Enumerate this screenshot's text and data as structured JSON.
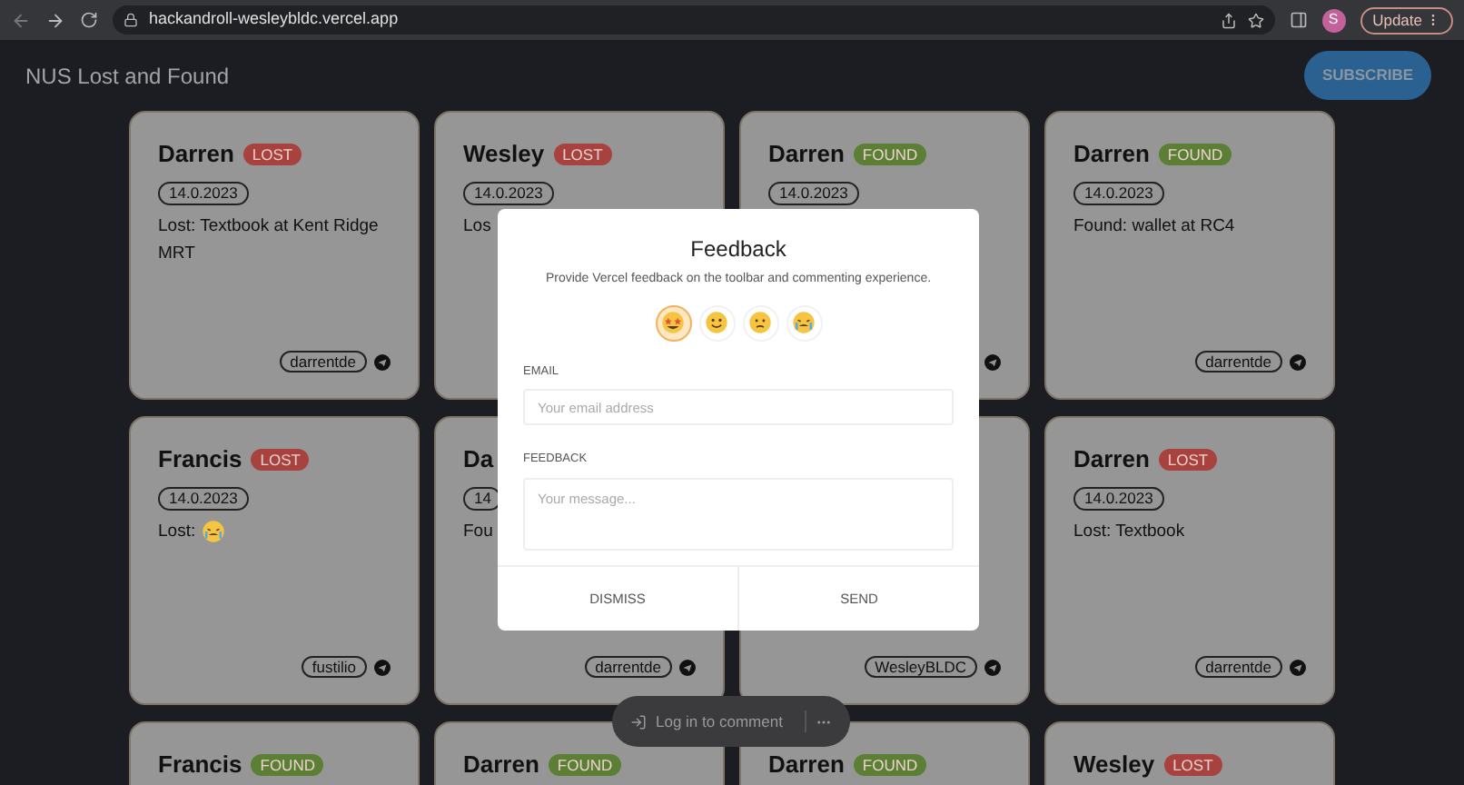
{
  "browser": {
    "url": "hackandroll-wesleybldc.vercel.app",
    "profile_initial": "S",
    "update_label": "Update"
  },
  "header": {
    "title": "NUS Lost and Found",
    "subscribe": "SUBSCRIBE"
  },
  "cards": [
    {
      "name": "Darren",
      "badge": "LOST",
      "color": "#a8423f",
      "date": "14.0.2023",
      "desc": "Lost: Textbook at Kent Ridge MRT",
      "handle": "darrentde"
    },
    {
      "name": "Wesley",
      "badge": "LOST",
      "color": "#a8423f",
      "date": "14.0.2023",
      "desc": "Los"
    },
    {
      "name": "Darren",
      "badge": "FOUND",
      "color": "#5b7f34",
      "date": "14.0.2023"
    },
    {
      "name": "Darren",
      "badge": "FOUND",
      "color": "#5b7f34",
      "date": "14.0.2023",
      "desc": "Found: wallet at RC4",
      "handle": "darrentde"
    },
    {
      "name": "Francis",
      "badge": "LOST",
      "color": "#a8423f",
      "date": "14.0.2023",
      "desc": "Lost:",
      "desc_emoji": true,
      "handle": "fustilio"
    },
    {
      "name": "Da",
      "date": "14",
      "desc": "Fou",
      "handle": "darrentde"
    },
    {
      "handle": "WesleyBLDC"
    },
    {
      "name": "Darren",
      "badge": "LOST",
      "color": "#a8423f",
      "date": "14.0.2023",
      "desc": "Lost: Textbook",
      "handle": "darrentde"
    },
    {
      "name": "Francis",
      "badge": "FOUND",
      "color": "#5b7f34"
    },
    {
      "name": "Darren",
      "badge": "FOUND",
      "color": "#5b7f34"
    },
    {
      "name": "Darren",
      "badge": "FOUND",
      "color": "#5b7f34"
    },
    {
      "name": "Wesley",
      "badge": "LOST",
      "color": "#a8423f"
    }
  ],
  "feedback": {
    "title": "Feedback",
    "subtitle": "Provide Vercel feedback on the toolbar and commenting experience.",
    "emojis": [
      {
        "kind": "star-eyes",
        "selected": true
      },
      {
        "kind": "smile",
        "selected": false
      },
      {
        "kind": "frown",
        "selected": false
      },
      {
        "kind": "crying",
        "selected": false
      }
    ],
    "email_label": "EMAIL",
    "email_placeholder": "Your email address",
    "feedback_label": "FEEDBACK",
    "feedback_placeholder": "Your message...",
    "dismiss": "DISMISS",
    "send": "SEND"
  },
  "comment_bar": {
    "label": "Log in to comment"
  }
}
